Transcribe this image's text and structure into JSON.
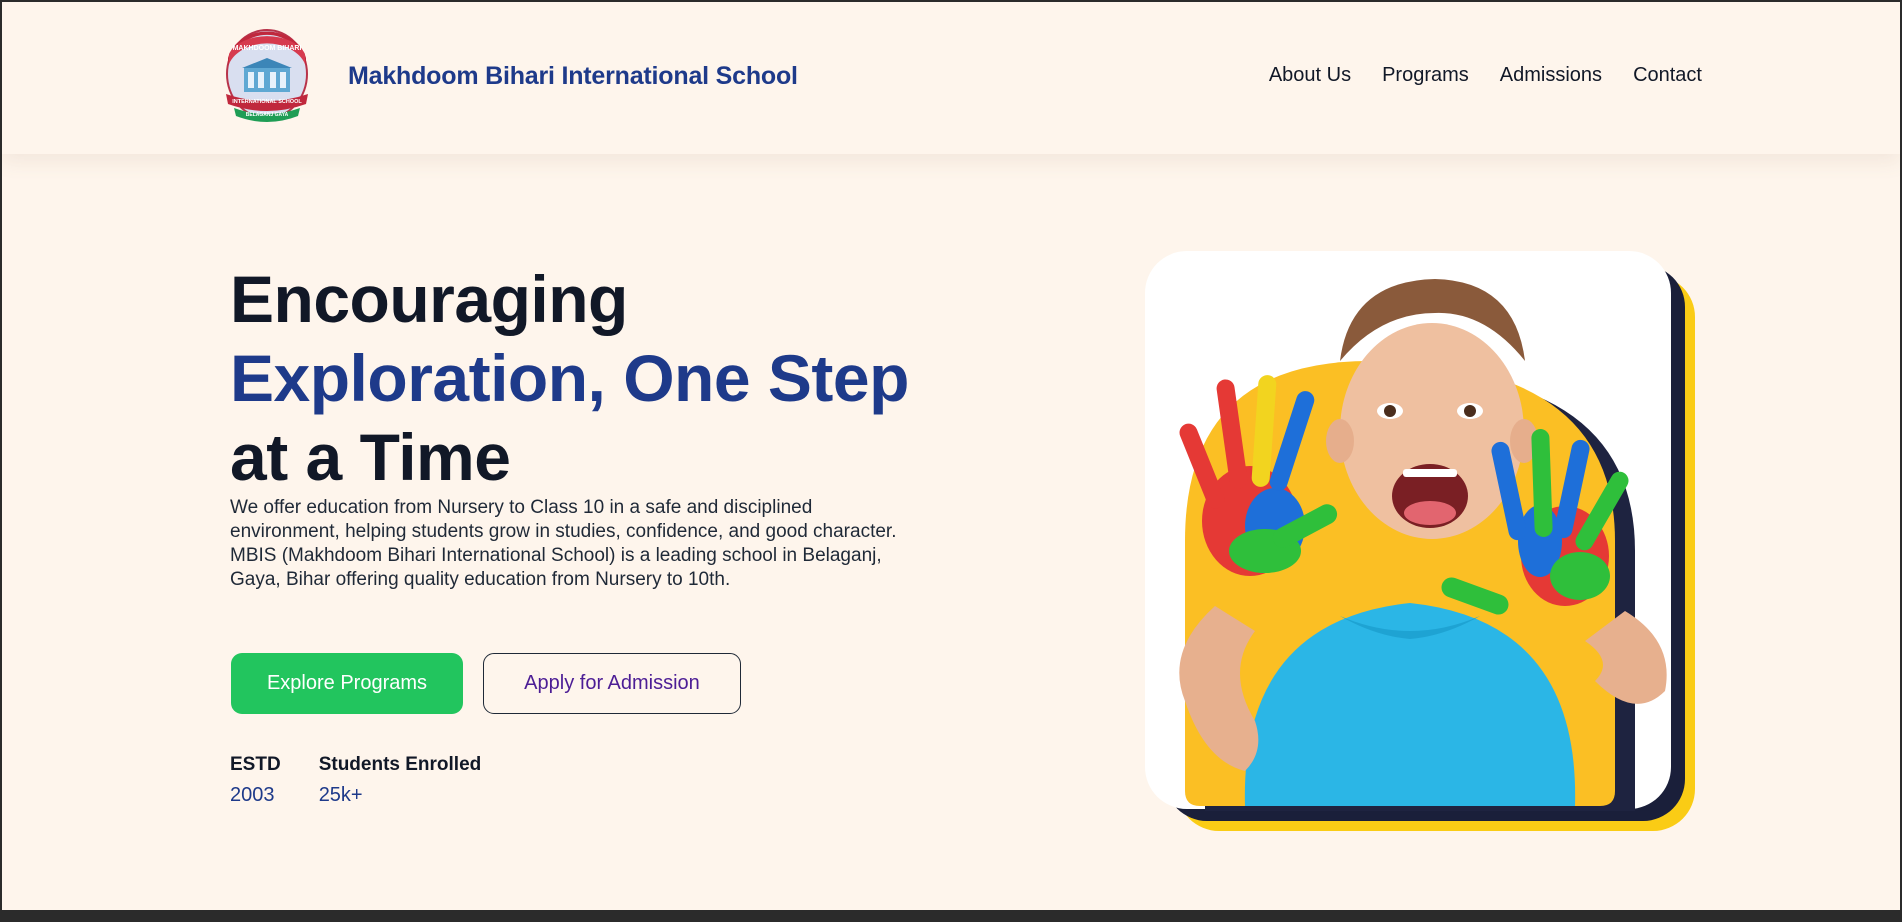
{
  "brand": {
    "name": "Makhdoom Bihari International School",
    "logo_text_top": "MAKHDOOM BIHARI",
    "logo_text_bottom": "INTERNATIONAL SCHOOL",
    "logo_text_place": "BELAGANJ GAYA"
  },
  "nav": {
    "items": [
      {
        "label": "About Us"
      },
      {
        "label": "Programs"
      },
      {
        "label": "Admissions"
      },
      {
        "label": "Contact"
      }
    ]
  },
  "hero": {
    "title_line1": "Encouraging",
    "title_accent": "Exploration, One Step",
    "title_line3": "at a Time",
    "desc_1": "We offer education from Nursery to Class 10 in a safe and disciplined environment, helping students grow in studies, confidence, and good character.",
    "desc_2": "MBIS (Makhdoom Bihari International School) is a leading school in Belaganj, Gaya, Bihar offering quality education from Nursery to 10th.",
    "primary_button": "Explore Programs",
    "secondary_button": "Apply for Admission"
  },
  "stats": [
    {
      "label": "ESTD",
      "value": "2003"
    },
    {
      "label": "Students Enrolled",
      "value": "25k+"
    }
  ],
  "colors": {
    "background": "#fef5ec",
    "brand_blue": "#1e3a8a",
    "button_green": "#22c55e",
    "button_outline_text": "#4c1d95",
    "frame_yellow": "#facc15",
    "frame_navy": "#1e2340"
  },
  "icons": {
    "logo": "school-crest-icon",
    "hero_image": "child-painted-hands-photo"
  }
}
